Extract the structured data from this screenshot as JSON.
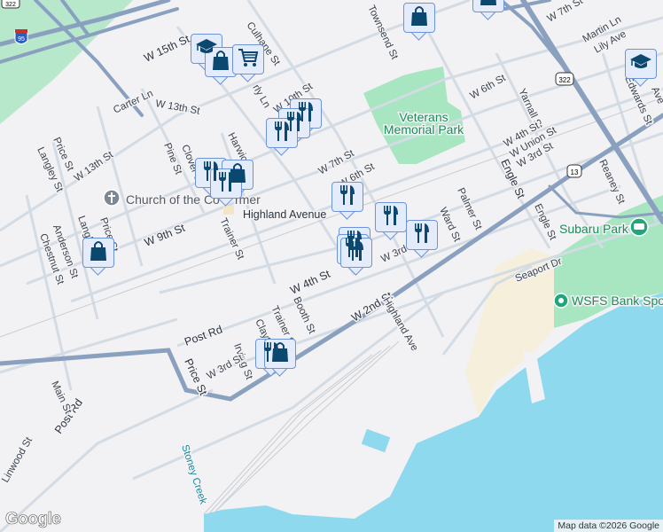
{
  "map": {
    "colors": {
      "land": "#f2f1f3",
      "water": "#8fd9ee",
      "park": "#a8e6c2",
      "highway": "#8aa0bf",
      "road": "#d3dbe4",
      "marker_fill": "#e4ecfb",
      "marker_icon": "#0b4870",
      "sand": "#f5efdc"
    },
    "streets": {
      "w15th": "W 15th St",
      "culhane": "Culhane St",
      "carter": "Carter Ln",
      "w13th_a": "W 13th St",
      "w10th": "W 10th St",
      "harwick": "Harwick",
      "price_a": "Price St",
      "langley_a": "Langley St",
      "w13th_b": "W 13th St",
      "pine": "Pine St",
      "clover": "Clover St",
      "w9th": "W 9th St",
      "trainer_a": "Trainer St",
      "anderson": "Anderson St",
      "chestnut": "Chestnut St",
      "langley_b": "Langl",
      "price_b": "Price St",
      "w7th_a": "W 7th St",
      "w6th_a": "W 6th St",
      "townsend": "Townsend St",
      "w6th_b": "W 6th St",
      "yarnall": "Yarnall St",
      "w4th_a": "W 4th St",
      "wunion": "W Union St",
      "w3rd_a": "W 3rd St",
      "engle_a": "Engle St",
      "engle_b": "Engle St",
      "palmer": "Palmer St",
      "ward": "Ward St",
      "reaney": "Reaney St",
      "edwards": "Edwards St",
      "martin": "Martin Ln",
      "lily": "Lily Ave",
      "w7th_b": "W 7th St",
      "w4th_b": "W 4th St",
      "post_a": "Post Rd",
      "post_b": "Post Rd",
      "booth": "Booth St",
      "trainer_b": "Trainer St",
      "clayton": "Clayt",
      "irving": "Irving St",
      "w3rd_b": "W 3rd St",
      "price_c": "Price St",
      "w2nd": "W 2nd St",
      "highland_ave": "Highland Ave",
      "seaport": "Seaport Dr",
      "main": "Main St",
      "linwood": "Linwood St",
      "w3rd_c": "W 3rd",
      "ave": "Ave",
      "early": "rly Ln"
    },
    "places": {
      "church": "Church of the Co",
      "church_tail": "rmer",
      "highland_station": "Highland Avenue",
      "veterans_1": "Veterans",
      "veterans_2": "Memorial Park",
      "subaru": "Subaru Park",
      "wsfs": "WSFS Bank Spo",
      "stoney": "Stoney Creek"
    },
    "shields": {
      "i95": "95",
      "us322_a": "322",
      "us322_b": "322",
      "us13": "13"
    },
    "markers": [
      "education",
      "shopping",
      "grocery-cart",
      "shopping",
      "shopping",
      "education",
      "restaurant",
      "restaurant",
      "restaurant",
      "restaurant",
      "shopping",
      "restaurant",
      "restaurant",
      "restaurant",
      "restaurant",
      "restaurant",
      "restaurant",
      "restaurant",
      "restaurant",
      "shopping"
    ],
    "attribution": "Map data ©2026 Google",
    "logo": "Google"
  }
}
